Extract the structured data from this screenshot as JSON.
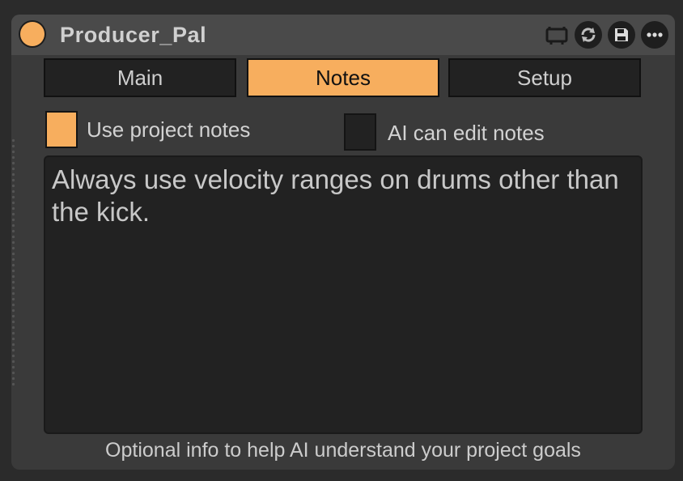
{
  "device": {
    "title": "Producer_Pal",
    "power_on": true,
    "icons": [
      "monitor-icon",
      "refresh-icon",
      "save-icon",
      "more-icon"
    ]
  },
  "tabs": [
    {
      "label": "Main",
      "active": false
    },
    {
      "label": "Notes",
      "active": true
    },
    {
      "label": "Setup",
      "active": false
    }
  ],
  "options": {
    "use_project_notes": {
      "label": "Use project notes",
      "checked": true
    },
    "ai_can_edit_notes": {
      "label": "AI can edit notes",
      "checked": false
    }
  },
  "notes": {
    "value": "Always use velocity ranges on drums other than the kick."
  },
  "hint": "Optional info to help AI understand your project goals",
  "colors": {
    "accent": "#f7ae5e",
    "panel": "#3a3a3a",
    "field": "#222222"
  }
}
